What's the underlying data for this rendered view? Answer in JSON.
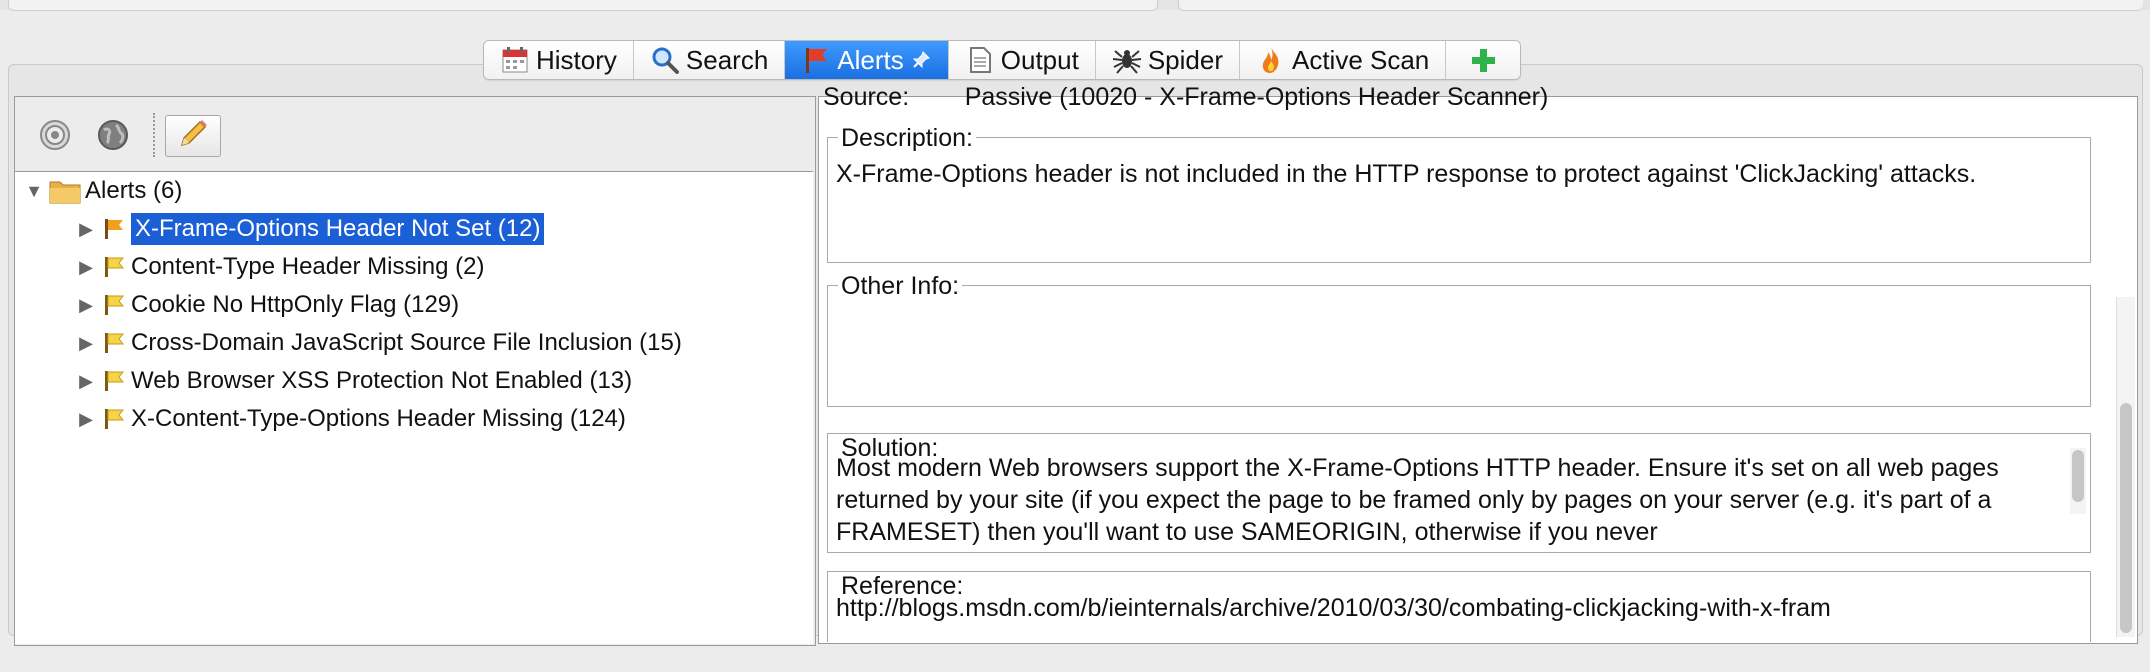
{
  "tabs": [
    {
      "label": "History",
      "icon": "calendar-icon"
    },
    {
      "label": "Search",
      "icon": "magnifier-icon"
    },
    {
      "label": "Alerts",
      "icon": "red-flag-icon",
      "pinned": true
    },
    {
      "label": "Output",
      "icon": "document-icon"
    },
    {
      "label": "Spider",
      "icon": "spider-icon"
    },
    {
      "label": "Active Scan",
      "icon": "flame-icon"
    },
    {
      "label": "",
      "icon": "add-icon"
    }
  ],
  "tree": {
    "root_label": "Alerts (6)",
    "items": [
      {
        "label": "X-Frame-Options Header Not Set (12)",
        "selected": true
      },
      {
        "label": "Content-Type Header Missing (2)",
        "selected": false
      },
      {
        "label": "Cookie No HttpOnly Flag (129)",
        "selected": false
      },
      {
        "label": "Cross-Domain JavaScript Source File Inclusion (15)",
        "selected": false
      },
      {
        "label": "Web Browser XSS Protection Not Enabled (13)",
        "selected": false
      },
      {
        "label": "X-Content-Type-Options Header Missing (124)",
        "selected": false
      }
    ]
  },
  "details": {
    "source_partial": "Source:        Passive (10020 - X-Frame-Options Header Scanner)",
    "description_title": "Description:",
    "description_text": "X-Frame-Options header is not included in the HTTP response to protect against 'ClickJacking' attacks.",
    "other_info_title": "Other Info:",
    "other_info_text": "",
    "solution_title": "Solution:",
    "solution_text": "Most modern Web browsers support the X-Frame-Options HTTP header. Ensure it's set on all web pages returned by your site (if you expect the page to be framed only by pages on your server (e.g. it's part of a FRAMESET) then you'll want to use SAMEORIGIN, otherwise if you never",
    "reference_title": "Reference:",
    "reference_text": "http://blogs.msdn.com/b/ieinternals/archive/2010/03/30/combating-clickjacking-with-x-fram"
  },
  "colors": {
    "selection": "#1b5fd6",
    "active_tab": "#2b84f0",
    "flag_orange": "#f0a020"
  }
}
